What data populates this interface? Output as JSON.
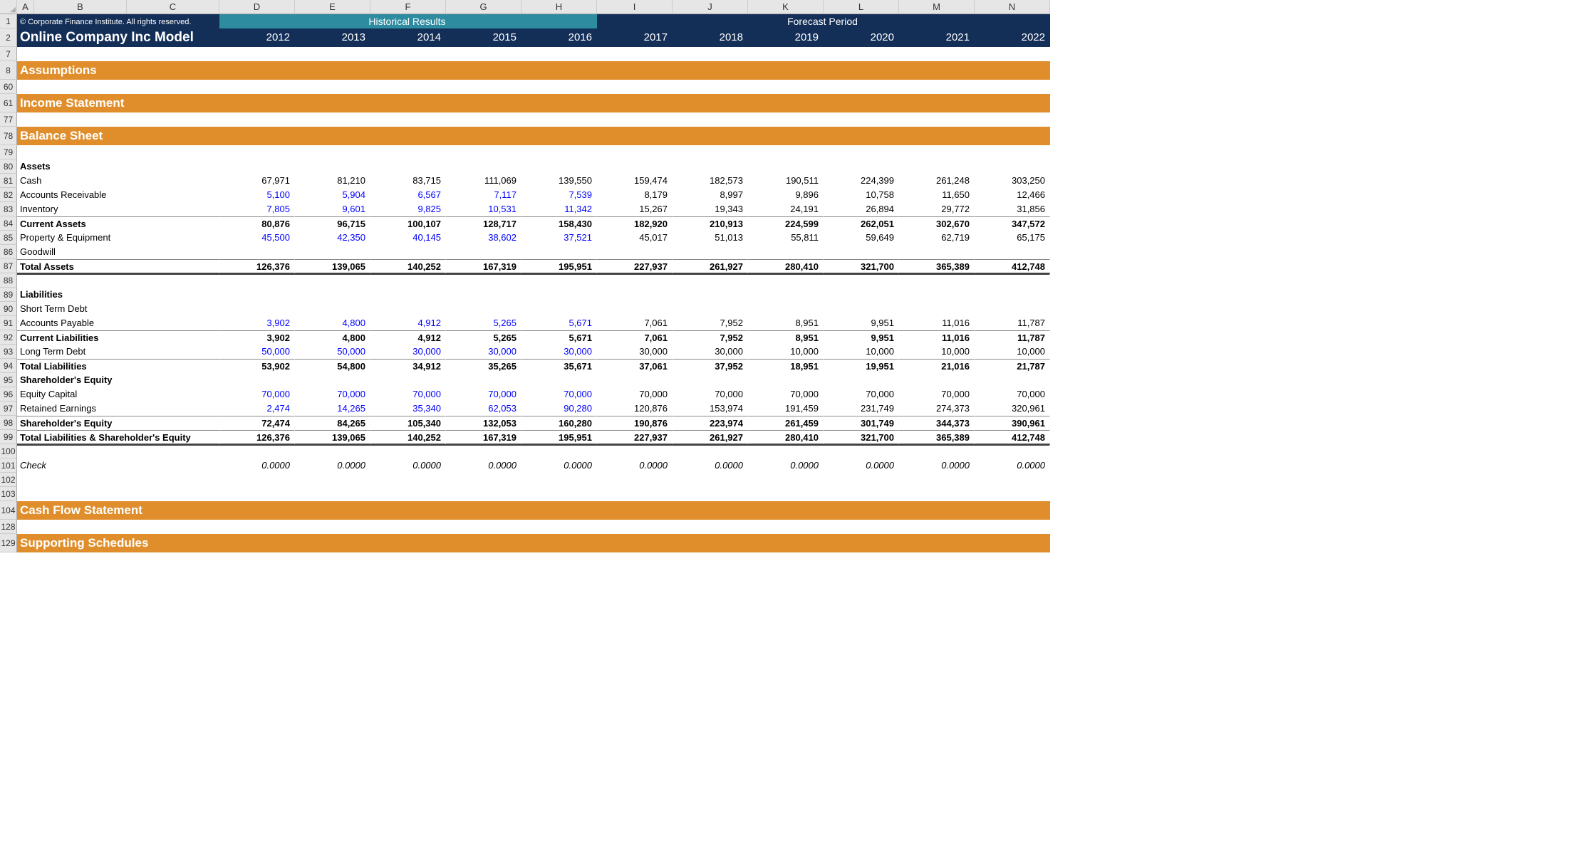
{
  "columns": [
    "A",
    "B",
    "C",
    "D",
    "E",
    "F",
    "G",
    "H",
    "I",
    "J",
    "K",
    "L",
    "M",
    "N"
  ],
  "copyright": "© Corporate Finance Institute. All rights reserved.",
  "title": "Online Company Inc Model",
  "band_historical": "Historical Results",
  "band_forecast": "Forecast Period",
  "years": [
    "2012",
    "2013",
    "2014",
    "2015",
    "2016",
    "2017",
    "2018",
    "2019",
    "2020",
    "2021",
    "2022"
  ],
  "sections": {
    "assumptions": "Assumptions",
    "income": "Income Statement",
    "balance": "Balance Sheet",
    "cashflow": "Cash Flow Statement",
    "supporting": "Supporting Schedules"
  },
  "labels": {
    "assets": "Assets",
    "cash": "Cash",
    "ar": "Accounts Receivable",
    "inventory": "Inventory",
    "current_assets": "Current Assets",
    "ppe": "Property & Equipment",
    "goodwill": "Goodwill",
    "total_assets": "Total Assets",
    "liabilities": "Liabilities",
    "std": "Short Term Debt",
    "ap": "Accounts Payable",
    "current_liab": "Current Liabilities",
    "ltd": "Long Term Debt",
    "total_liab": "Total Liabilities",
    "she": "Shareholder's Equity",
    "equity_cap": "Equity Capital",
    "retained": "Retained Earnings",
    "she_total": "Shareholder's Equity",
    "tlse": "Total Liabilities & Shareholder's Equity",
    "check": "Check"
  },
  "row_numbers": {
    "r1": "1",
    "r2": "2",
    "r7": "7",
    "r8": "8",
    "r60": "60",
    "r61": "61",
    "r77": "77",
    "r78": "78",
    "r79": "79",
    "r80": "80",
    "r81": "81",
    "r82": "82",
    "r83": "83",
    "r84": "84",
    "r85": "85",
    "r86": "86",
    "r87": "87",
    "r88": "88",
    "r89": "89",
    "r90": "90",
    "r91": "91",
    "r92": "92",
    "r93": "93",
    "r94": "94",
    "r95": "95",
    "r96": "96",
    "r97": "97",
    "r98": "98",
    "r99": "99",
    "r100": "100",
    "r101": "101",
    "r102": "102",
    "r103": "103",
    "r104": "104",
    "r128": "128",
    "r129": "129"
  },
  "chart_data": {
    "type": "table",
    "title": "Balance Sheet — Online Company Inc Model",
    "historical_years": [
      2012,
      2013,
      2014,
      2015,
      2016
    ],
    "forecast_years": [
      2017,
      2018,
      2019,
      2020,
      2021,
      2022
    ],
    "rows": [
      {
        "name": "Cash",
        "values": [
          67971,
          81210,
          83715,
          111069,
          139550,
          159474,
          182573,
          190511,
          224399,
          261248,
          303250
        ]
      },
      {
        "name": "Accounts Receivable",
        "values": [
          5100,
          5904,
          6567,
          7117,
          7539,
          8179,
          8997,
          9896,
          10758,
          11650,
          12466
        ],
        "historical_input": true
      },
      {
        "name": "Inventory",
        "values": [
          7805,
          9601,
          9825,
          10531,
          11342,
          15267,
          19343,
          24191,
          26894,
          29772,
          31856
        ],
        "historical_input": true
      },
      {
        "name": "Current Assets",
        "values": [
          80876,
          96715,
          100107,
          128717,
          158430,
          182920,
          210913,
          224599,
          262051,
          302670,
          347572
        ],
        "subtotal": true
      },
      {
        "name": "Property & Equipment",
        "values": [
          45500,
          42350,
          40145,
          38602,
          37521,
          45017,
          51013,
          55811,
          59649,
          62719,
          65175
        ],
        "historical_input": true
      },
      {
        "name": "Goodwill",
        "values": [
          null,
          null,
          null,
          null,
          null,
          null,
          null,
          null,
          null,
          null,
          null
        ]
      },
      {
        "name": "Total Assets",
        "values": [
          126376,
          139065,
          140252,
          167319,
          195951,
          227937,
          261927,
          280410,
          321700,
          365389,
          412748
        ],
        "total": true
      },
      {
        "name": "Short Term Debt",
        "values": [
          null,
          null,
          null,
          null,
          null,
          null,
          null,
          null,
          null,
          null,
          null
        ]
      },
      {
        "name": "Accounts Payable",
        "values": [
          3902,
          4800,
          4912,
          5265,
          5671,
          7061,
          7952,
          8951,
          9951,
          11016,
          11787
        ],
        "historical_input": true
      },
      {
        "name": "Current Liabilities",
        "values": [
          3902,
          4800,
          4912,
          5265,
          5671,
          7061,
          7952,
          8951,
          9951,
          11016,
          11787
        ],
        "subtotal": true
      },
      {
        "name": "Long Term Debt",
        "values": [
          50000,
          50000,
          30000,
          30000,
          30000,
          30000,
          30000,
          10000,
          10000,
          10000,
          10000
        ],
        "historical_input": true
      },
      {
        "name": "Total Liabilities",
        "values": [
          53902,
          54800,
          34912,
          35265,
          35671,
          37061,
          37952,
          18951,
          19951,
          21016,
          21787
        ],
        "total": true
      },
      {
        "name": "Equity Capital",
        "values": [
          70000,
          70000,
          70000,
          70000,
          70000,
          70000,
          70000,
          70000,
          70000,
          70000,
          70000
        ],
        "historical_input": true
      },
      {
        "name": "Retained Earnings",
        "values": [
          2474,
          14265,
          35340,
          62053,
          90280,
          120876,
          153974,
          191459,
          231749,
          274373,
          320961
        ],
        "historical_input": true
      },
      {
        "name": "Shareholder's Equity",
        "values": [
          72474,
          84265,
          105340,
          132053,
          160280,
          190876,
          223974,
          261459,
          301749,
          344373,
          390961
        ],
        "subtotal": true
      },
      {
        "name": "Total Liabilities & Shareholder's Equity",
        "values": [
          126376,
          139065,
          140252,
          167319,
          195951,
          227937,
          261927,
          280410,
          321700,
          365389,
          412748
        ],
        "total": true
      },
      {
        "name": "Check",
        "values": [
          0,
          0,
          0,
          0,
          0,
          0,
          0,
          0,
          0,
          0,
          0
        ],
        "format": "0.0000"
      }
    ]
  }
}
